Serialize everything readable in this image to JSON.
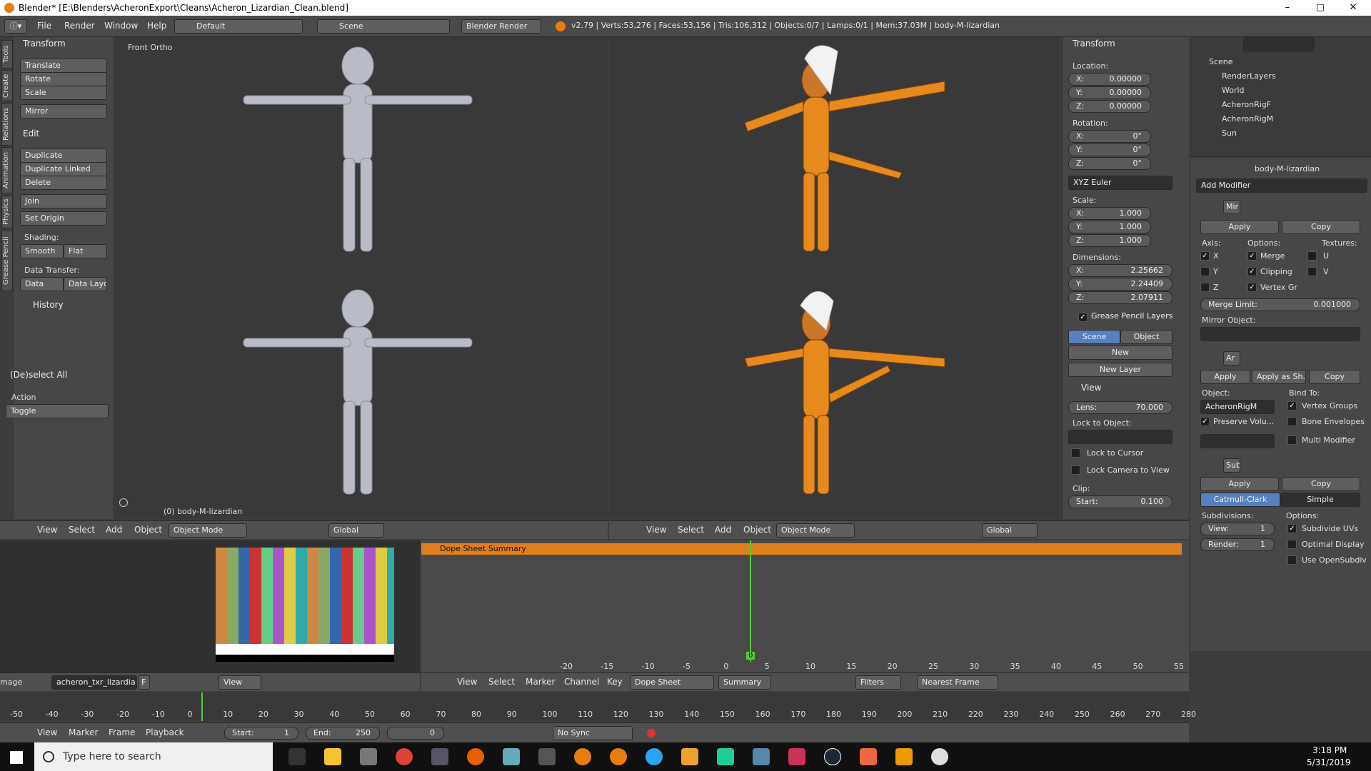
{
  "titlebar": {
    "title": "Blender* [E:\\Blenders\\AcheronExport\\Cleans\\Acheron_Lizardian_Clean.blend]",
    "min": "–",
    "max": "▢",
    "close": "✕"
  },
  "info": {
    "menus": [
      "File",
      "Render",
      "Window",
      "Help"
    ],
    "layout": "Default",
    "scene": "Scene",
    "engine": "Blender Render",
    "stats": "v2.79 | Verts:53,276 | Faces:53,156 | Tris:106,312 | Objects:0/7 | Lamps:0/1 | Mem:37.03M | body-M-lizardian"
  },
  "toolshelf": {
    "tabs": [
      "Tools",
      "Create",
      "Relations",
      "Animation",
      "Physics",
      "Grease Pencil"
    ],
    "transform_header": "Transform",
    "translate": "Translate",
    "rotate": "Rotate",
    "scale": "Scale",
    "mirror": "Mirror",
    "edit_header": "Edit",
    "duplicate": "Duplicate",
    "duplicate_linked": "Duplicate Linked",
    "delete": "Delete",
    "join": "Join",
    "set_origin": "Set Origin",
    "shading": "Shading:",
    "smooth": "Smooth",
    "flat": "Flat",
    "data_transfer": "Data Transfer:",
    "data": "Data",
    "data_layo": "Data Layo",
    "history": "History",
    "deselect_header": "(De)select All",
    "action": "Action",
    "toggle": "Toggle"
  },
  "viewport_left": {
    "label": "Front Ortho",
    "object": "(0) body-M-lizardian"
  },
  "view3d_header": {
    "view": "View",
    "select": "Select",
    "add": "Add",
    "object": "Object",
    "mode": "Object Mode",
    "orient": "Global"
  },
  "npanel": {
    "transform": "Transform",
    "location": "Location:",
    "loc": [
      "X:",
      "0.00000",
      "Y:",
      "0.00000",
      "Z:",
      "0.00000"
    ],
    "rotation": "Rotation:",
    "rot": [
      "X:",
      "0°",
      "Y:",
      "0°",
      "Z:",
      "0°"
    ],
    "euler": "XYZ Euler",
    "scale": "Scale:",
    "scl": [
      "X:",
      "1.000",
      "Y:",
      "1.000",
      "Z:",
      "1.000"
    ],
    "dimensions": "Dimensions:",
    "dim": [
      "X:",
      "2.25662",
      "Y:",
      "2.24409",
      "Z:",
      "2.07911"
    ],
    "gp_layers": "Grease Pencil Layers",
    "gp_scene": "Scene",
    "gp_object": "Object",
    "gp_new": "New",
    "gp_new_layer": "New Layer",
    "view": "View",
    "lens_label": "Lens:",
    "lens": "70.000",
    "lock_to_object": "Lock to Object:",
    "lock_cursor": "Lock to Cursor",
    "lock_camera": "Lock Camera to View",
    "clip": "Clip:",
    "clip_start": "Start:",
    "clip_start_val": "0.100"
  },
  "outliner": {
    "items": [
      "Scene",
      "RenderLayers",
      "World",
      "AcheronRigF",
      "AcheronRigM",
      "Sun"
    ]
  },
  "properties": {
    "object_name": "body-M-lizardian",
    "add_modifier": "Add Modifier",
    "mirror": {
      "name": "Mir",
      "apply": "Apply",
      "copy": "Copy",
      "axis": "Axis:",
      "options": "Options:",
      "textures": "Textures:",
      "x": "X",
      "y": "Y",
      "z": "Z",
      "merge": "Merge",
      "clipping": "Clipping",
      "vertex_gr": "Vertex Gr",
      "u": "U",
      "v": "V",
      "merge_limit": "Merge Limit:",
      "merge_limit_val": "0.001000",
      "mirror_object": "Mirror Object:"
    },
    "armature": {
      "name": "Ar",
      "apply": "Apply",
      "apply_as": "Apply as Sh...",
      "copy": "Copy",
      "object": "Object:",
      "bind_to": "Bind To:",
      "object_val": "AcheronRigM",
      "vertex_groups": "Vertex Groups",
      "preserve": "Preserve Volu...",
      "bone_envelopes": "Bone Envelopes",
      "multi": "Multi Modifier"
    },
    "subsurf": {
      "name": "Sub",
      "apply": "Apply",
      "copy": "Copy",
      "catmull": "Catmull-Clark",
      "simple": "Simple",
      "subdivisions": "Subdivisions:",
      "options": "Options:",
      "view": "View:",
      "view_val": "1",
      "render": "Render:",
      "render_val": "1",
      "subdivide_uvs": "Subdivide UVs",
      "optimal": "Optimal Display",
      "opensubdiv": "Use OpenSubdiv"
    }
  },
  "image_editor": {
    "label": "mage",
    "image": "acheron_txr_lizardia...",
    "f": "F",
    "view": "View"
  },
  "dopesheet": {
    "summary": "Dope Sheet Summary",
    "frame": "0",
    "ticks": [
      "-20",
      "-15",
      "-10",
      "-5",
      "0",
      "5",
      "10",
      "15",
      "20",
      "25",
      "30",
      "35",
      "40",
      "45",
      "50",
      "55"
    ],
    "hdr": {
      "view": "View",
      "select": "Select",
      "marker": "Marker",
      "channel": "Channel",
      "key": "Key",
      "mode": "Dope Sheet",
      "summary": "Summary",
      "filters": "Filters",
      "snap": "Nearest Frame"
    }
  },
  "timeline": {
    "ticks": [
      "-50",
      "-40",
      "-30",
      "-20",
      "-10",
      "0",
      "10",
      "20",
      "30",
      "40",
      "50",
      "60",
      "70",
      "80",
      "90",
      "100",
      "110",
      "120",
      "130",
      "140",
      "150",
      "160",
      "170",
      "180",
      "190",
      "200",
      "210",
      "220",
      "230",
      "240",
      "250",
      "260",
      "270",
      "280"
    ],
    "view": "View",
    "marker": "Marker",
    "frame": "Frame",
    "playback": "Playback",
    "start": "Start:",
    "start_val": "1",
    "end": "End:",
    "end_val": "250",
    "current": "0",
    "sync": "No Sync"
  },
  "taskbar": {
    "search": "Type here to search",
    "time": "3:18 PM",
    "date": "5/31/2019"
  },
  "colors": {
    "accent": "#5680c2",
    "orange": "#e68a1e",
    "green": "#55cc33"
  }
}
